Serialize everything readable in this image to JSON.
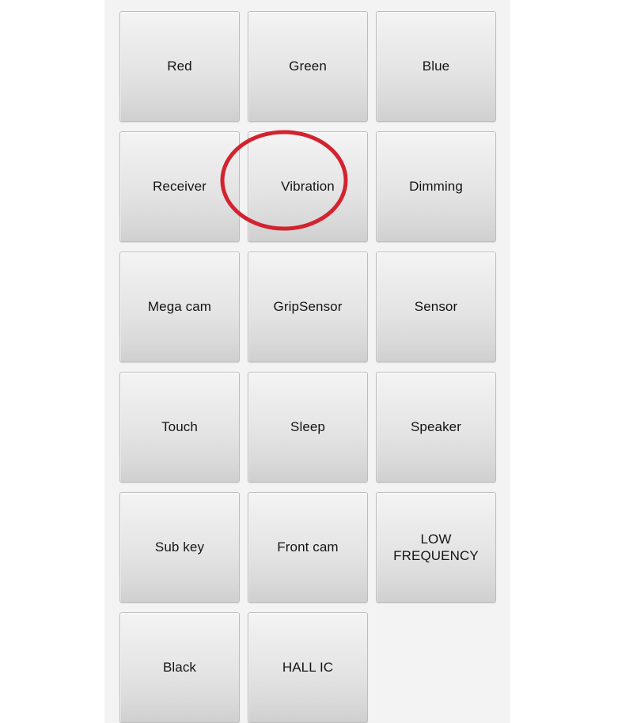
{
  "screen": {
    "background_color": "#ffffff",
    "panel_background_color": "#f3f3f3"
  },
  "annotation": {
    "type": "ellipse-highlight",
    "color": "#d2232f",
    "stroke_width": 5,
    "target_label": "Receiver"
  },
  "button_grid": {
    "columns": 3,
    "rows": 6,
    "button_text_color": "#141414",
    "buttons": [
      {
        "label": "Red"
      },
      {
        "label": "Green"
      },
      {
        "label": "Blue"
      },
      {
        "label": "Receiver"
      },
      {
        "label": "Vibration"
      },
      {
        "label": "Dimming"
      },
      {
        "label": "Mega cam"
      },
      {
        "label": "GripSensor"
      },
      {
        "label": "Sensor"
      },
      {
        "label": "Touch"
      },
      {
        "label": "Sleep"
      },
      {
        "label": "Speaker"
      },
      {
        "label": "Sub key"
      },
      {
        "label": "Front cam"
      },
      {
        "label": "LOW\nFREQUENCY"
      },
      {
        "label": "Black"
      },
      {
        "label": "HALL IC"
      }
    ]
  }
}
